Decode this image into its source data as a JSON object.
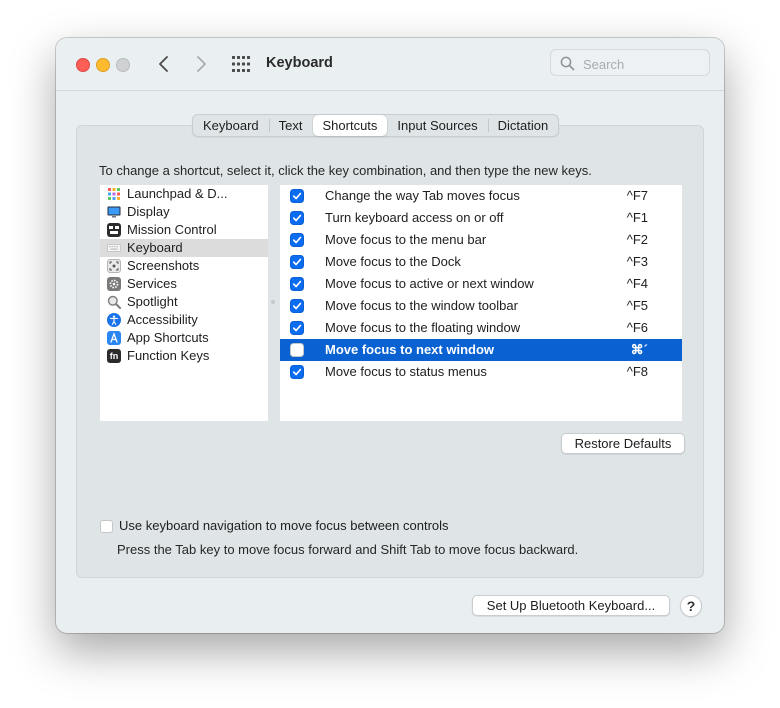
{
  "window": {
    "title": "Keyboard",
    "search_placeholder": "Search"
  },
  "tabs": [
    {
      "label": "Keyboard",
      "active": false
    },
    {
      "label": "Text",
      "active": false
    },
    {
      "label": "Shortcuts",
      "active": true
    },
    {
      "label": "Input Sources",
      "active": false
    },
    {
      "label": "Dictation",
      "active": false
    }
  ],
  "instruction": "To change a shortcut, select it, click the key combination, and then type the new keys.",
  "categories": [
    {
      "label": "Launchpad & D...",
      "icon": "launchpad-icon",
      "color": "#f5a623",
      "selected": false
    },
    {
      "label": "Display",
      "icon": "display-icon",
      "color": "#1c7ed6",
      "selected": false
    },
    {
      "label": "Mission Control",
      "icon": "mission-control-icon",
      "color": "#2b2b2b",
      "selected": false
    },
    {
      "label": "Keyboard",
      "icon": "keyboard-icon",
      "color": "#e8e8e8",
      "selected": true
    },
    {
      "label": "Screenshots",
      "icon": "screenshots-icon",
      "color": "#8a8a8a",
      "selected": false
    },
    {
      "label": "Services",
      "icon": "services-icon",
      "color": "#7a7a7a",
      "selected": false
    },
    {
      "label": "Spotlight",
      "icon": "spotlight-icon",
      "color": "#8a8a8a",
      "selected": false
    },
    {
      "label": "Accessibility",
      "icon": "accessibility-icon",
      "color": "#1a73e8",
      "selected": false
    },
    {
      "label": "App Shortcuts",
      "icon": "app-shortcuts-icon",
      "color": "#2a86f0",
      "selected": false
    },
    {
      "label": "Function Keys",
      "icon": "function-keys-icon",
      "color": "#2b2b2b",
      "selected": false
    }
  ],
  "shortcuts": [
    {
      "label": "Change the way Tab moves focus",
      "key": "^F7",
      "checked": true,
      "selected": false
    },
    {
      "label": "Turn keyboard access on or off",
      "key": "^F1",
      "checked": true,
      "selected": false
    },
    {
      "label": "Move focus to the menu bar",
      "key": "^F2",
      "checked": true,
      "selected": false
    },
    {
      "label": "Move focus to the Dock",
      "key": "^F3",
      "checked": true,
      "selected": false
    },
    {
      "label": "Move focus to active or next window",
      "key": "^F4",
      "checked": true,
      "selected": false
    },
    {
      "label": "Move focus to the window toolbar",
      "key": "^F5",
      "checked": true,
      "selected": false
    },
    {
      "label": "Move focus to the floating window",
      "key": "^F6",
      "checked": true,
      "selected": false
    },
    {
      "label": "Move focus to next window",
      "key": "⌘´",
      "checked": false,
      "selected": true
    },
    {
      "label": "Move focus to status menus",
      "key": "^F8",
      "checked": true,
      "selected": false
    }
  ],
  "buttons": {
    "restore_defaults": "Restore Defaults",
    "setup_bluetooth": "Set Up Bluetooth Keyboard...",
    "help": "?"
  },
  "keyboard_navigation": {
    "label": "Use keyboard navigation to move focus between controls",
    "checked": false,
    "hint": "Press the Tab key to move focus forward and Shift Tab to move focus backward."
  },
  "colors": {
    "selection": "#0a62d2",
    "checkbox": "#0a6cf0"
  }
}
